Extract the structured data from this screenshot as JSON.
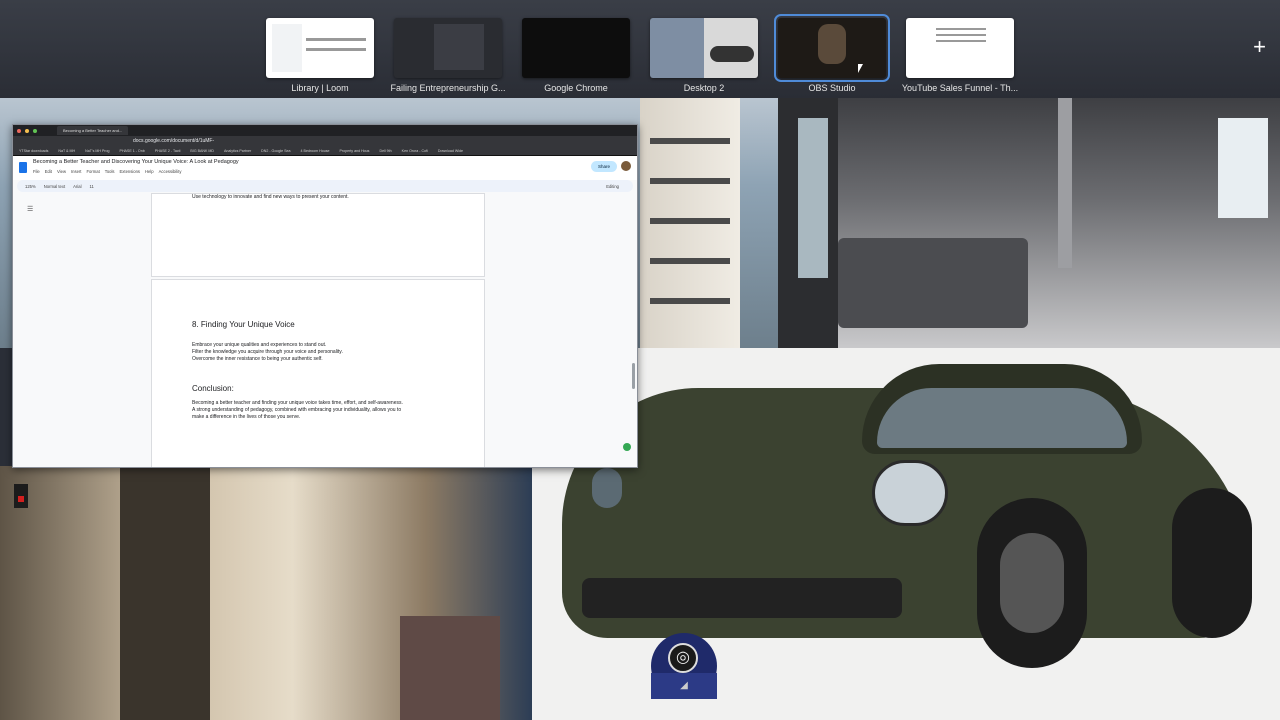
{
  "spaces": [
    {
      "label": "Library | Loom",
      "selected": false
    },
    {
      "label": "Failing Entrepreneurship G...",
      "selected": false
    },
    {
      "label": "Google Chrome",
      "selected": false
    },
    {
      "label": "Desktop 2",
      "selected": false
    },
    {
      "label": "OBS Studio",
      "selected": true
    },
    {
      "label": "YouTube Sales Funnel - Th...",
      "selected": false
    }
  ],
  "add_space_label": "+",
  "browser": {
    "tab_title": "Becoming a Better Teacher and...",
    "url": "docs.google.com/document/d/1uMF-",
    "bookmarks": [
      "YTStar downloads",
      "NaT & MH",
      "NaT's MH Prog",
      "PHASE 1 - Onb",
      "PHASE 2 - Tacti",
      "BIG BANK MD",
      "Analytics Partner",
      "DN2 - Google Sea",
      "4 Bedroom House",
      "Property and Hous",
      "Dell 9th",
      "Ken Orora - Cofi",
      "Download Wide"
    ]
  },
  "doc": {
    "title": "Becoming a Better Teacher and Discovering Your Unique Voice: A Look at Pedagogy",
    "menus": [
      "File",
      "Edit",
      "View",
      "Insert",
      "Format",
      "Tools",
      "Extensions",
      "Help",
      "Accessibility"
    ],
    "share_label": "Share",
    "toolbar": {
      "zoom": "125%",
      "style": "Normal text",
      "font": "Arial",
      "size": "11",
      "mode": "Editing"
    },
    "top_line": "Use technology to innovate and find new ways to present your content.",
    "section_heading": "8. Finding Your Unique Voice",
    "section_lines": [
      "Embrace your unique qualities and experiences to stand out.",
      "Filter the knowledge you acquire through your voice and personality.",
      "Overcome the inner resistance to being your authentic self."
    ],
    "conclusion_heading": "Conclusion:",
    "conclusion_lines": [
      "Becoming a better teacher and finding your unique voice takes time, effort, and self-awareness.",
      "A strong understanding of pedagogy, combined with embracing your individuality, allows you to",
      "make a difference in the lives of those you serve."
    ]
  },
  "colors": {
    "accent": "#4f8bd8",
    "docs_blue": "#1a73e8",
    "car": "#3b4230"
  },
  "icons": [
    "plus-icon",
    "docs-icon",
    "obs-icon",
    "list-outline-icon"
  ]
}
